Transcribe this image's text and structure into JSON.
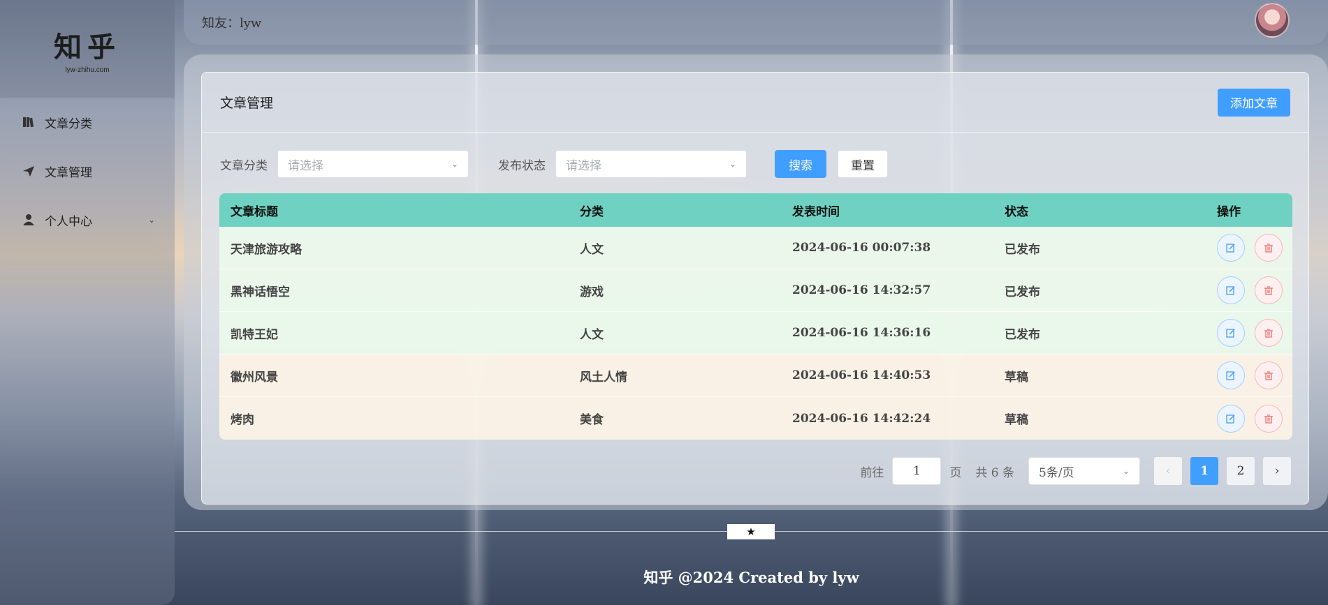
{
  "sidebar": {
    "logo_title": "知乎",
    "logo_sub": "lyw-zhihu.com",
    "items": [
      {
        "label": "文章分类",
        "icon": "book-icon"
      },
      {
        "label": "文章管理",
        "icon": "paper-plane-icon"
      },
      {
        "label": "个人中心",
        "icon": "user-icon"
      }
    ]
  },
  "header": {
    "user_text": "知友：lyw"
  },
  "panel": {
    "title": "文章管理",
    "add_button": "添加文章"
  },
  "filters": {
    "category_label": "文章分类",
    "category_placeholder": "请选择",
    "status_label": "发布状态",
    "status_placeholder": "请选择",
    "search_button": "搜索",
    "reset_button": "重置"
  },
  "table": {
    "headers": [
      "文章标题",
      "分类",
      "发表时间",
      "状态",
      "操作"
    ],
    "rows": [
      {
        "title": "天津旅游攻略",
        "category": "人文",
        "time": "2024-06-16 00:07:38",
        "status": "已发布"
      },
      {
        "title": "黑神话悟空",
        "category": "游戏",
        "time": "2024-06-16 14:32:57",
        "status": "已发布"
      },
      {
        "title": "凯特王妃",
        "category": "人文",
        "time": "2024-06-16 14:36:16",
        "status": "已发布"
      },
      {
        "title": "徽州风景",
        "category": "风土人情",
        "time": "2024-06-16 14:40:53",
        "status": "草稿"
      },
      {
        "title": "烤肉",
        "category": "美食",
        "time": "2024-06-16 14:42:24",
        "status": "草稿"
      }
    ]
  },
  "pagination": {
    "goto_prefix": "前往",
    "goto_value": "1",
    "goto_suffix": "页",
    "total": "共 6 条",
    "page_size": "5条/页",
    "pages": [
      "1",
      "2"
    ],
    "current": "1"
  },
  "footer": {
    "star": "★",
    "text": "知乎 @2024 Created by lyw"
  },
  "colors": {
    "primary": "#409eff",
    "table_header": "#6fd1c2",
    "published_row": "#ecf8ec",
    "draft_row": "#fcf3e6"
  }
}
